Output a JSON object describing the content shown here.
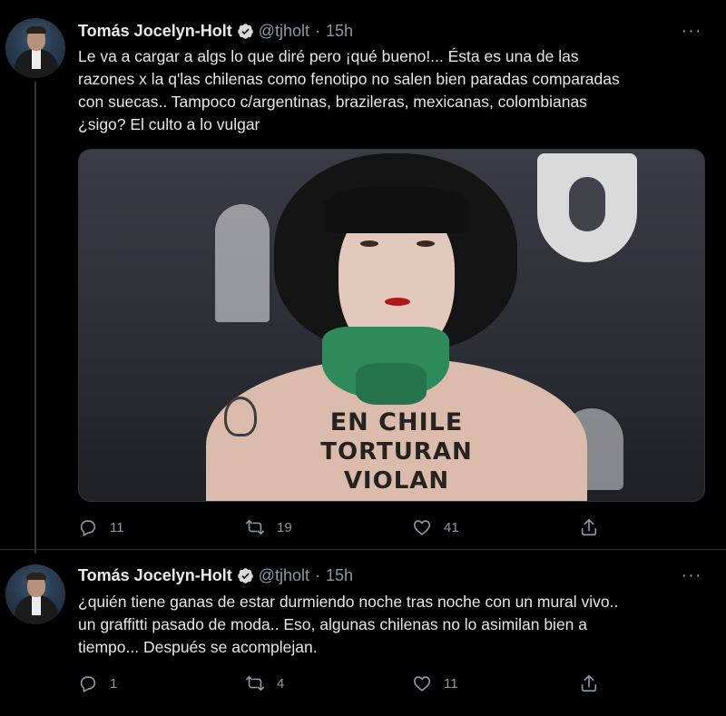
{
  "tweets": [
    {
      "author_name": "Tomás Jocelyn-Holt",
      "handle": "@tjholt",
      "separator": "·",
      "time": "15h",
      "more_glyph": "···",
      "text_lines": [
        "Le va a cargar a algs lo que diré pero ¡qué bueno!... Ésta es una de las",
        "razones x la q'las chilenas como fenotipo no salen bien paradas comparadas",
        "con suecas.. Tampoco c/argentinas, brazileras, mexicanas, colombianas",
        "¿sigo? El culto a lo vulgar"
      ],
      "media": {
        "body_text_lines": [
          "EN CHILE",
          "TORTURAN",
          "VIOLAN"
        ]
      },
      "actions": {
        "reply_count": "11",
        "retweet_count": "19",
        "like_count": "41"
      }
    },
    {
      "author_name": "Tomás Jocelyn-Holt",
      "handle": "@tjholt",
      "separator": "·",
      "time": "15h",
      "more_glyph": "···",
      "text_lines": [
        "¿quién tiene ganas de estar durmiendo noche tras noche con un mural vivo..",
        "un graffitti pasado de moda.. Eso, algunas chilenas no lo asimilan bien a",
        "tiempo... Después se acomplejan."
      ],
      "actions": {
        "reply_count": "1",
        "retweet_count": "4",
        "like_count": "11"
      }
    }
  ],
  "colors": {
    "background": "#000000",
    "text_primary": "#e7e9ea",
    "text_secondary": "#8b98a5",
    "verified_badge": "#d9d9d9",
    "thread_line": "#333639"
  },
  "icons": [
    "verified-badge-icon",
    "more-icon",
    "reply-icon",
    "retweet-icon",
    "like-icon",
    "share-icon"
  ]
}
